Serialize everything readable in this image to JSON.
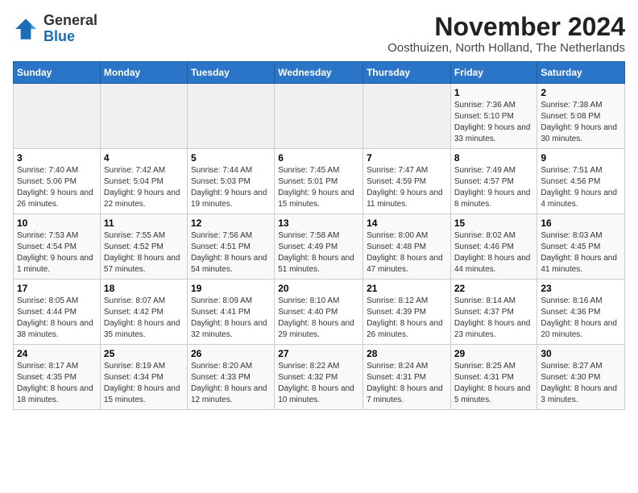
{
  "logo": {
    "general": "General",
    "blue": "Blue"
  },
  "header": {
    "month": "November 2024",
    "location": "Oosthuizen, North Holland, The Netherlands"
  },
  "weekdays": [
    "Sunday",
    "Monday",
    "Tuesday",
    "Wednesday",
    "Thursday",
    "Friday",
    "Saturday"
  ],
  "weeks": [
    [
      {
        "day": "",
        "empty": true
      },
      {
        "day": "",
        "empty": true
      },
      {
        "day": "",
        "empty": true
      },
      {
        "day": "",
        "empty": true
      },
      {
        "day": "",
        "empty": true
      },
      {
        "day": "1",
        "sunrise": "Sunrise: 7:36 AM",
        "sunset": "Sunset: 5:10 PM",
        "daylight": "Daylight: 9 hours and 33 minutes."
      },
      {
        "day": "2",
        "sunrise": "Sunrise: 7:38 AM",
        "sunset": "Sunset: 5:08 PM",
        "daylight": "Daylight: 9 hours and 30 minutes."
      }
    ],
    [
      {
        "day": "3",
        "sunrise": "Sunrise: 7:40 AM",
        "sunset": "Sunset: 5:06 PM",
        "daylight": "Daylight: 9 hours and 26 minutes."
      },
      {
        "day": "4",
        "sunrise": "Sunrise: 7:42 AM",
        "sunset": "Sunset: 5:04 PM",
        "daylight": "Daylight: 9 hours and 22 minutes."
      },
      {
        "day": "5",
        "sunrise": "Sunrise: 7:44 AM",
        "sunset": "Sunset: 5:03 PM",
        "daylight": "Daylight: 9 hours and 19 minutes."
      },
      {
        "day": "6",
        "sunrise": "Sunrise: 7:45 AM",
        "sunset": "Sunset: 5:01 PM",
        "daylight": "Daylight: 9 hours and 15 minutes."
      },
      {
        "day": "7",
        "sunrise": "Sunrise: 7:47 AM",
        "sunset": "Sunset: 4:59 PM",
        "daylight": "Daylight: 9 hours and 11 minutes."
      },
      {
        "day": "8",
        "sunrise": "Sunrise: 7:49 AM",
        "sunset": "Sunset: 4:57 PM",
        "daylight": "Daylight: 9 hours and 8 minutes."
      },
      {
        "day": "9",
        "sunrise": "Sunrise: 7:51 AM",
        "sunset": "Sunset: 4:56 PM",
        "daylight": "Daylight: 9 hours and 4 minutes."
      }
    ],
    [
      {
        "day": "10",
        "sunrise": "Sunrise: 7:53 AM",
        "sunset": "Sunset: 4:54 PM",
        "daylight": "Daylight: 9 hours and 1 minute."
      },
      {
        "day": "11",
        "sunrise": "Sunrise: 7:55 AM",
        "sunset": "Sunset: 4:52 PM",
        "daylight": "Daylight: 8 hours and 57 minutes."
      },
      {
        "day": "12",
        "sunrise": "Sunrise: 7:56 AM",
        "sunset": "Sunset: 4:51 PM",
        "daylight": "Daylight: 8 hours and 54 minutes."
      },
      {
        "day": "13",
        "sunrise": "Sunrise: 7:58 AM",
        "sunset": "Sunset: 4:49 PM",
        "daylight": "Daylight: 8 hours and 51 minutes."
      },
      {
        "day": "14",
        "sunrise": "Sunrise: 8:00 AM",
        "sunset": "Sunset: 4:48 PM",
        "daylight": "Daylight: 8 hours and 47 minutes."
      },
      {
        "day": "15",
        "sunrise": "Sunrise: 8:02 AM",
        "sunset": "Sunset: 4:46 PM",
        "daylight": "Daylight: 8 hours and 44 minutes."
      },
      {
        "day": "16",
        "sunrise": "Sunrise: 8:03 AM",
        "sunset": "Sunset: 4:45 PM",
        "daylight": "Daylight: 8 hours and 41 minutes."
      }
    ],
    [
      {
        "day": "17",
        "sunrise": "Sunrise: 8:05 AM",
        "sunset": "Sunset: 4:44 PM",
        "daylight": "Daylight: 8 hours and 38 minutes."
      },
      {
        "day": "18",
        "sunrise": "Sunrise: 8:07 AM",
        "sunset": "Sunset: 4:42 PM",
        "daylight": "Daylight: 8 hours and 35 minutes."
      },
      {
        "day": "19",
        "sunrise": "Sunrise: 8:09 AM",
        "sunset": "Sunset: 4:41 PM",
        "daylight": "Daylight: 8 hours and 32 minutes."
      },
      {
        "day": "20",
        "sunrise": "Sunrise: 8:10 AM",
        "sunset": "Sunset: 4:40 PM",
        "daylight": "Daylight: 8 hours and 29 minutes."
      },
      {
        "day": "21",
        "sunrise": "Sunrise: 8:12 AM",
        "sunset": "Sunset: 4:39 PM",
        "daylight": "Daylight: 8 hours and 26 minutes."
      },
      {
        "day": "22",
        "sunrise": "Sunrise: 8:14 AM",
        "sunset": "Sunset: 4:37 PM",
        "daylight": "Daylight: 8 hours and 23 minutes."
      },
      {
        "day": "23",
        "sunrise": "Sunrise: 8:16 AM",
        "sunset": "Sunset: 4:36 PM",
        "daylight": "Daylight: 8 hours and 20 minutes."
      }
    ],
    [
      {
        "day": "24",
        "sunrise": "Sunrise: 8:17 AM",
        "sunset": "Sunset: 4:35 PM",
        "daylight": "Daylight: 8 hours and 18 minutes."
      },
      {
        "day": "25",
        "sunrise": "Sunrise: 8:19 AM",
        "sunset": "Sunset: 4:34 PM",
        "daylight": "Daylight: 8 hours and 15 minutes."
      },
      {
        "day": "26",
        "sunrise": "Sunrise: 8:20 AM",
        "sunset": "Sunset: 4:33 PM",
        "daylight": "Daylight: 8 hours and 12 minutes."
      },
      {
        "day": "27",
        "sunrise": "Sunrise: 8:22 AM",
        "sunset": "Sunset: 4:32 PM",
        "daylight": "Daylight: 8 hours and 10 minutes."
      },
      {
        "day": "28",
        "sunrise": "Sunrise: 8:24 AM",
        "sunset": "Sunset: 4:31 PM",
        "daylight": "Daylight: 8 hours and 7 minutes."
      },
      {
        "day": "29",
        "sunrise": "Sunrise: 8:25 AM",
        "sunset": "Sunset: 4:31 PM",
        "daylight": "Daylight: 8 hours and 5 minutes."
      },
      {
        "day": "30",
        "sunrise": "Sunrise: 8:27 AM",
        "sunset": "Sunset: 4:30 PM",
        "daylight": "Daylight: 8 hours and 3 minutes."
      }
    ]
  ]
}
